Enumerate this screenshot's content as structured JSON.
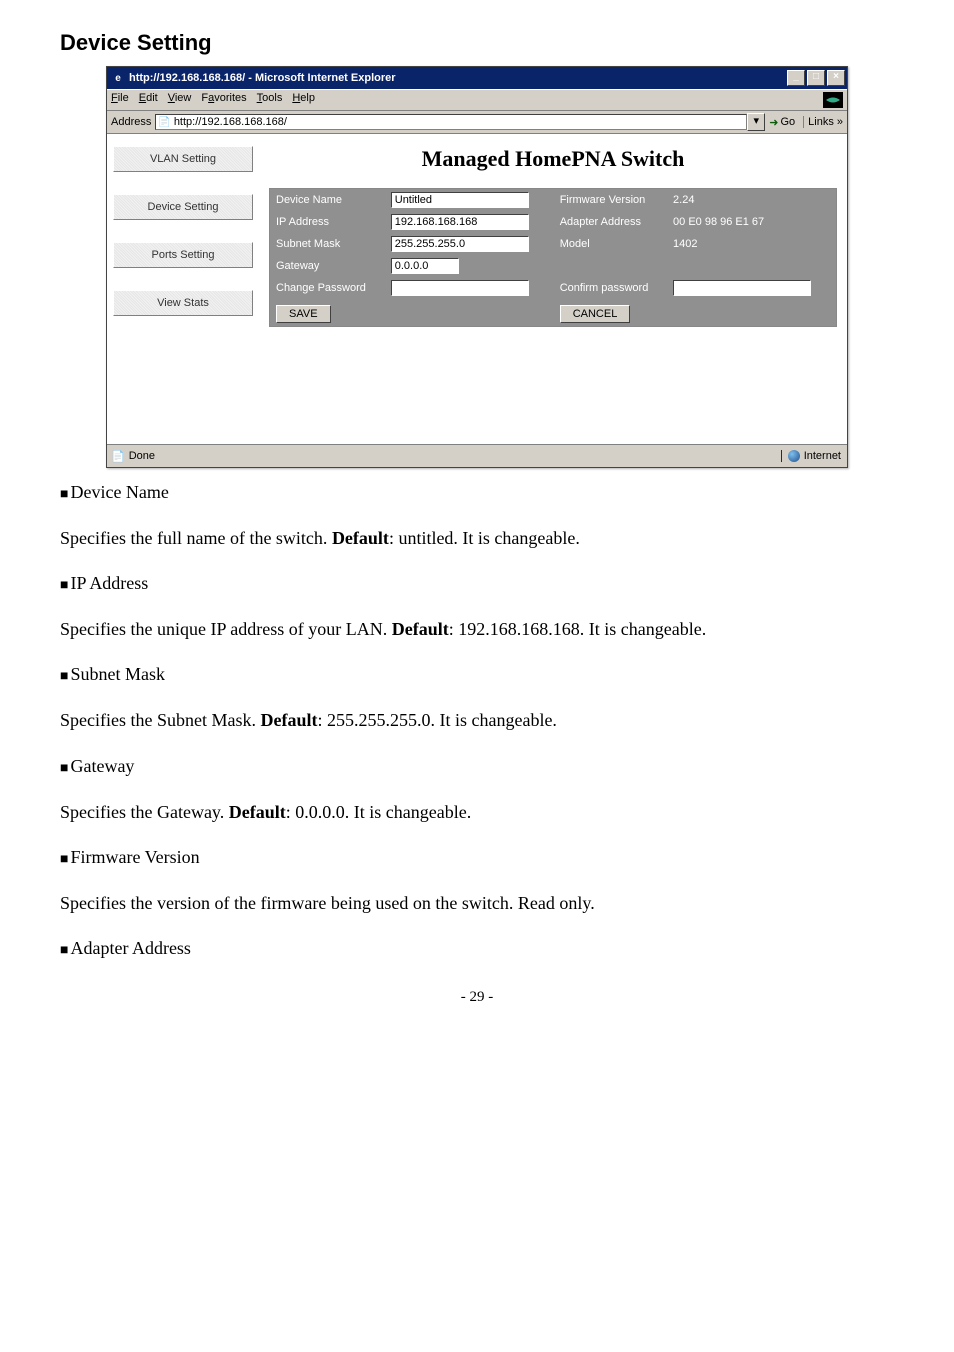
{
  "doc": {
    "heading": "Device Setting",
    "sections": {
      "device_name": {
        "label": "Device Name",
        "text": "Specifies the full name of the switch. ",
        "default_label": "Default",
        "default_value": ": untitled.    It is changeable."
      },
      "ip_address": {
        "label": "IP Address",
        "text1": "Specifies the unique IP address of your LAN. ",
        "default_label": "Default",
        "text2": ": 192.168.168.168.  It is changeable."
      },
      "subnet": {
        "label": "Subnet Mask",
        "text1": "Specifies the Subnet Mask. ",
        "default_label": "Default",
        "text2": ": 255.255.255.0.    It is changeable."
      },
      "gateway": {
        "label": "Gateway",
        "text1": "Specifies the Gateway. ",
        "default_label": "Default",
        "text2": ": 0.0.0.0.    It is changeable."
      },
      "firmware": {
        "label": "Firmware Version",
        "text": "Specifies the version of the firmware being used on the switch. Read only."
      },
      "adapter": {
        "label": "Adapter Address"
      }
    },
    "page_number": "- 29 -"
  },
  "browser": {
    "title": "http://192.168.168.168/ - Microsoft Internet Explorer",
    "menus": {
      "file": "File",
      "edit": "Edit",
      "view": "View",
      "favorites": "Favorites",
      "tools": "Tools",
      "help": "Help"
    },
    "address_label": "Address",
    "address_value": "http://192.168.168.168/",
    "go_label": "Go",
    "links_label": "Links »",
    "status_left": "Done",
    "status_zone": "Internet"
  },
  "page": {
    "title": "Managed HomePNA Switch",
    "sidebar": {
      "vlan": "VLAN Setting",
      "device": "Device Setting",
      "ports": "Ports Setting",
      "stats": "View Stats"
    },
    "labels": {
      "device_name": "Device Name",
      "ip_address": "IP Address",
      "subnet_mask": "Subnet Mask",
      "gateway": "Gateway",
      "change_password": "Change Password",
      "firmware_version": "Firmware Version",
      "adapter_address": "Adapter Address",
      "model": "Model",
      "confirm_password": "Confirm password"
    },
    "values": {
      "device_name": "Untitled",
      "ip_address": "192.168.168.168",
      "subnet_mask": "255.255.255.0",
      "gateway": "0.0.0.0",
      "firmware_version": "2.24",
      "adapter_address": "00 E0 98 96 E1 67",
      "model": "1402"
    },
    "buttons": {
      "save": "SAVE",
      "cancel": "CANCEL"
    }
  }
}
